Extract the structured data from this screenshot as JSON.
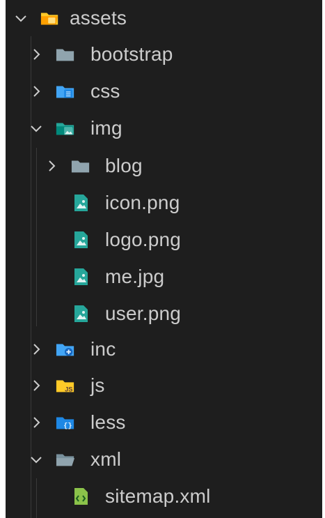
{
  "explorer": {
    "items": [
      {
        "label": "assets",
        "icon": "folder-assets-open-icon",
        "chevron": "chevron-down-icon",
        "depth": 0,
        "open": true
      },
      {
        "label": "bootstrap",
        "icon": "folder-icon",
        "chevron": "chevron-right-icon",
        "depth": 1,
        "open": false
      },
      {
        "label": "css",
        "icon": "folder-css-icon",
        "chevron": "chevron-right-icon",
        "depth": 1,
        "open": false
      },
      {
        "label": "img",
        "icon": "folder-images-open-icon",
        "chevron": "chevron-down-icon",
        "depth": 1,
        "open": true
      },
      {
        "label": "blog",
        "icon": "folder-icon",
        "chevron": "chevron-right-icon",
        "depth": 2,
        "open": false
      },
      {
        "label": "icon.png",
        "icon": "image-file-icon",
        "chevron": "",
        "depth": 2
      },
      {
        "label": "logo.png",
        "icon": "image-file-icon",
        "chevron": "",
        "depth": 2
      },
      {
        "label": "me.jpg",
        "icon": "image-file-icon",
        "chevron": "",
        "depth": 2
      },
      {
        "label": "user.png",
        "icon": "image-file-icon",
        "chevron": "",
        "depth": 2
      },
      {
        "label": "inc",
        "icon": "folder-include-icon",
        "chevron": "chevron-right-icon",
        "depth": 1,
        "open": false
      },
      {
        "label": "js",
        "icon": "folder-javascript-icon",
        "chevron": "chevron-right-icon",
        "depth": 1,
        "open": false
      },
      {
        "label": "less",
        "icon": "folder-less-icon",
        "chevron": "chevron-right-icon",
        "depth": 1,
        "open": false
      },
      {
        "label": "xml",
        "icon": "folder-open-icon",
        "chevron": "chevron-down-icon",
        "depth": 1,
        "open": true
      },
      {
        "label": "sitemap.xml",
        "icon": "xml-file-icon",
        "chevron": "",
        "depth": 2
      }
    ]
  },
  "colors": {
    "background": "#1e1e1e",
    "text": "#cccccc",
    "guide": "#3a3a3a",
    "folder_gray": "#90a4ae",
    "folder_yellow": "#ffca28",
    "folder_blue": "#42a5f5",
    "folder_teal": "#26a69a",
    "xml_green": "#8bc34a"
  }
}
